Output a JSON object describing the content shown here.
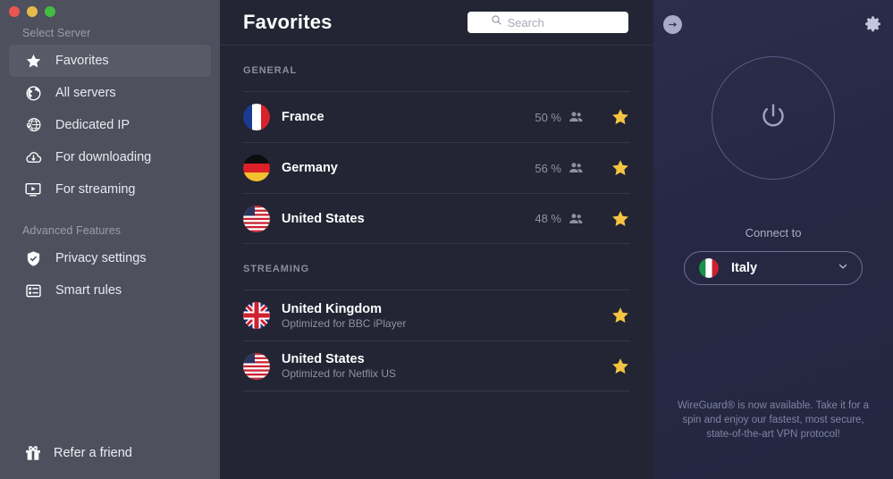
{
  "window": {
    "traffic_lights": [
      {
        "name": "close",
        "color": "#e8564f"
      },
      {
        "name": "minimize",
        "color": "#e5bc4a"
      },
      {
        "name": "zoom",
        "color": "#42bd41"
      }
    ]
  },
  "sidebar": {
    "select_server_label": "Select Server",
    "advanced_features_label": "Advanced Features",
    "items": [
      {
        "label": "Favorites",
        "icon": "star-icon",
        "active": true
      },
      {
        "label": "All servers",
        "icon": "globe-icon",
        "active": false
      },
      {
        "label": "Dedicated IP",
        "icon": "globe-pin-icon",
        "active": false
      },
      {
        "label": "For downloading",
        "icon": "cloud-download-icon",
        "active": false
      },
      {
        "label": "For streaming",
        "icon": "monitor-play-icon",
        "active": false
      }
    ],
    "advanced_items": [
      {
        "label": "Privacy settings",
        "icon": "shield-check-icon",
        "active": false
      },
      {
        "label": "Smart rules",
        "icon": "list-rules-icon",
        "active": false
      }
    ],
    "refer": {
      "label": "Refer a friend",
      "icon": "gift-icon"
    }
  },
  "main": {
    "title": "Favorites",
    "search": {
      "value": "",
      "placeholder": "Search",
      "icon": "search-icon"
    },
    "groups": [
      {
        "label": "GENERAL",
        "rows": [
          {
            "country": "France",
            "flag": "flag-france",
            "subtitle": "",
            "load": "50 %",
            "users_icon": "people-icon",
            "starred": true
          },
          {
            "country": "Germany",
            "flag": "flag-germany",
            "subtitle": "",
            "load": "56 %",
            "users_icon": "people-icon",
            "starred": true
          },
          {
            "country": "United States",
            "flag": "flag-usa",
            "subtitle": "",
            "load": "48 %",
            "users_icon": "people-icon",
            "starred": true
          }
        ]
      },
      {
        "label": "STREAMING",
        "rows": [
          {
            "country": "United Kingdom",
            "flag": "flag-uk",
            "subtitle": "Optimized for BBC iPlayer",
            "load": "",
            "users_icon": "",
            "starred": true
          },
          {
            "country": "United States",
            "flag": "flag-usa",
            "subtitle": "Optimized for Netflix US",
            "load": "",
            "users_icon": "",
            "starred": true
          }
        ]
      }
    ]
  },
  "right_panel": {
    "back_button_icon": "arrow-right-circle-icon",
    "settings_icon": "gear-icon",
    "power_button_icon": "power-icon",
    "connect_to_label": "Connect to",
    "selected_country": {
      "name": "Italy",
      "flag": "flag-italy"
    },
    "dropdown_icon": "chevron-down-icon",
    "promo_text": "WireGuard® is now available. Take it for a spin and enjoy our fastest, most secure, state-of-the-art VPN protocol!"
  },
  "colors": {
    "sidebar_bg": "#4e505e",
    "list_bg": "#232534",
    "panel_bg": "#262843",
    "star_gold": "#f5c542",
    "accent_purple": "#6c6f92"
  }
}
